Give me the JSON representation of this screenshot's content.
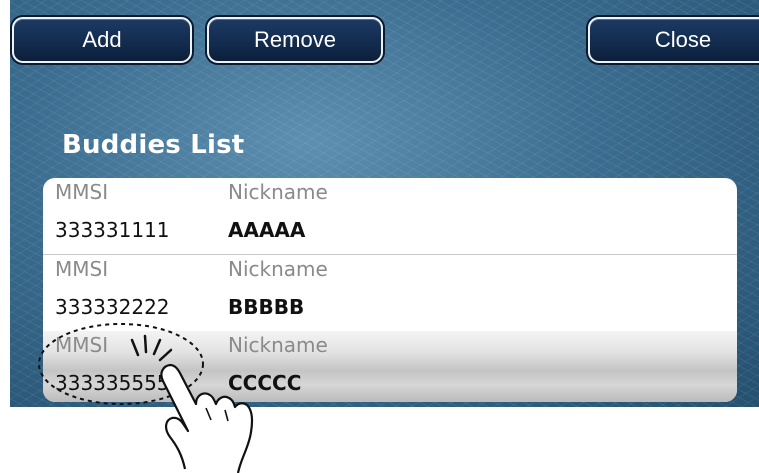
{
  "toolbar": {
    "add_label": "Add",
    "remove_label": "Remove",
    "close_label": "Close"
  },
  "buddies": {
    "title": "Buddies List",
    "rows": [
      {
        "mmsi_header": "MMSI",
        "nickname_header": "Nickname",
        "mmsi": "333331111",
        "nickname": "AAAAA"
      },
      {
        "mmsi_header": "MMSI",
        "nickname_header": "Nickname",
        "mmsi": "333332222",
        "nickname": "BBBBB"
      },
      {
        "mmsi_header": "MMSI",
        "nickname_header": "Nickname",
        "mmsi": "333335555",
        "nickname": "CCCCC",
        "selected": true
      }
    ]
  },
  "icons": {
    "pointer": "tap-hand-icon"
  },
  "colors": {
    "button_fill": "#132c4f",
    "button_border": "#eef3f8",
    "background": "#3b6d90"
  }
}
